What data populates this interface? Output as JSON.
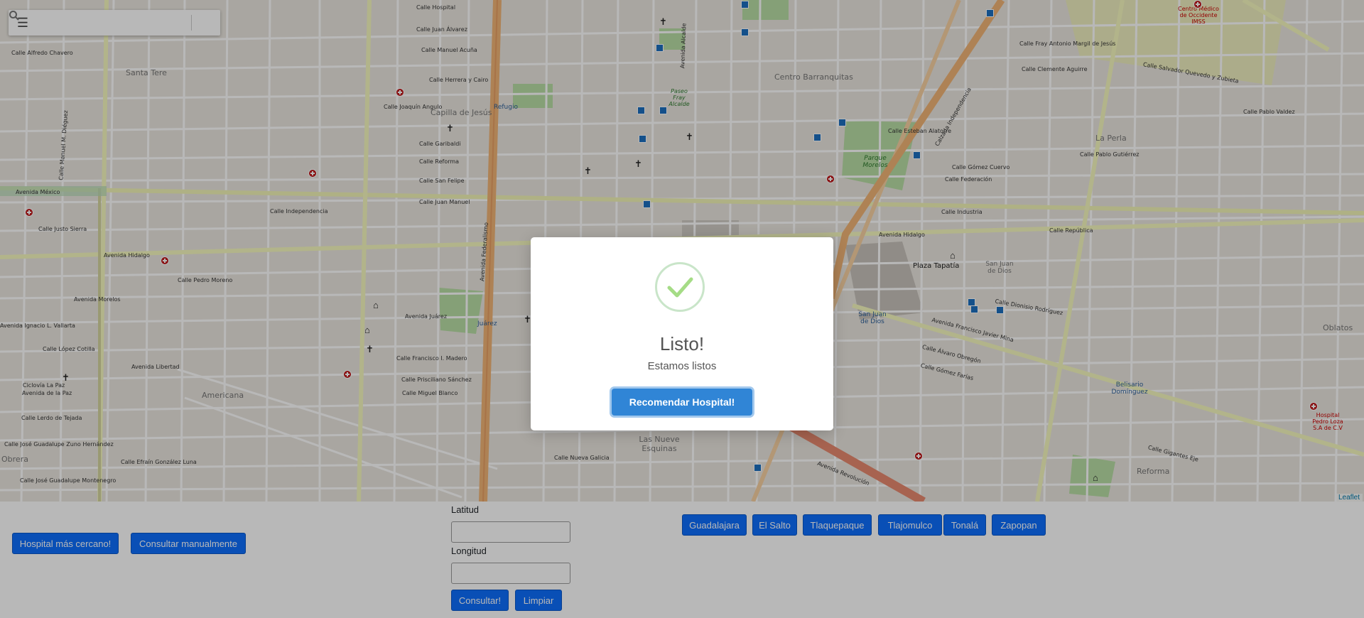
{
  "map": {
    "attribution": "Leaflet",
    "labels": {
      "santa_tere": "Santa Tere",
      "capilla": "Capilla de Jesús",
      "refugio": "Refugio",
      "paseo": "Paseo Fray Alcalde",
      "centro": "Centro Barranquitas",
      "parque": "Parque Morelos",
      "la_perla": "La Perla",
      "plaza": "Plaza Tapatía",
      "sjd": "San Juan de Dios",
      "sjd2": "San Juan de Dios",
      "juarez": "Juárez",
      "americana": "Americana",
      "obrera": "Obrera",
      "nueve": "Las Nueve Esquinas",
      "belisario": "Belisario Domínguez",
      "oblatos": "Oblatos",
      "reforma": "Reforma",
      "centro_medico": "Centro Médico de Occidente IMSS",
      "hosp_pedro": "Hospital Pedro Loza S.A de C.V",
      "av_mexico": "Avenida México",
      "av_hidalgo": "Avenida Hidalgo",
      "av_hidalgo2": "Avenida Hidalgo",
      "av_morelos": "Avenida Morelos",
      "av_juarez": "Avenida Juárez",
      "av_vallarta": "Avenida Ignacio L. Vallarta",
      "av_libertad": "Avenida Libertad",
      "av_la_paz": "Avenida de la Paz",
      "av_revolucion": "Avenida Revolución",
      "av_mina": "Avenida Francisco Javier Mina",
      "av_fed": "Avenida Federalismo",
      "av_alcalde": "Avenida Alcalde",
      "calz_indep": "Calzada Independencia",
      "c_hospital": "Calle Hospital",
      "c_juan_alvarez": "Calle Juan Álvarez",
      "c_manuel_acuna": "Calle Manuel Acuña",
      "c_herrera": "Calle Herrera y Cairo",
      "c_angulo": "Calle Joaquín Angulo",
      "c_garibaldi": "Calle Garibaldi",
      "c_reforma": "Calle Reforma",
      "c_san_felipe": "Calle San Felipe",
      "c_juan_manuel": "Calle Juan Manuel",
      "c_independencia": "Calle Independencia",
      "c_justo_sierra": "Calle Justo Sierra",
      "c_republica": "Calle República",
      "c_madero": "Calle Francisco I. Madero",
      "c_sanchez": "Calle Prisciliano Sánchez",
      "c_miguel_blanco": "Calle Miguel Blanco",
      "c_gigantes": "Calle Gigantes Eje",
      "c_gomez_farias": "Calle Gómez Farías",
      "c_federacion": "Calle Federación",
      "c_industria": "Calle Industria",
      "c_alvaro": "Calle Álvaro Obregón",
      "c_dionisio": "Calle Dionisio Rodríguez",
      "c_salvador": "Calle Salvador Quevedo y Zubieta",
      "c_esteban": "Calle Esteban Alatorre",
      "c_pablo_valdez": "Calle Pablo Valdez",
      "c_gomez_cuervo": "Calle Gómez Cuervo",
      "c_alfredo": "Calle Alfredo Chavero",
      "c_tejada": "Calle Lerdo de Tejada",
      "c_efrain": "Calle Efraín González Luna",
      "c_guadalupe": "Calle José Guadalupe Montenegro",
      "c_zuno": "Calle José Guadalupe Zuno Hernández",
      "c_nueva_galicia": "Calle Nueva Galicia",
      "c_lopez_cotilla": "Calle López Cotilla",
      "c_pedro_moreno": "Calle Pedro Moreno",
      "c_la_paz": "Ciclovía La Paz",
      "c_manuel_dieguez": "Calle Manuel M. Diéguez",
      "c_fray_angulo": "Calle Fray Antonio Margil de Jesús",
      "c_clemente": "Calle Clemente Aguirre",
      "c_pablo_gutierrez": "Calle Pablo Gutiérrez"
    }
  },
  "panel": {
    "nearest_label": "Hospital más cercano!",
    "manual_label": "Consultar manualmente",
    "lat_label": "Latitud",
    "lon_label": "Longitud",
    "lat_value": "",
    "lon_value": "",
    "consult_label": "Consultar!",
    "clear_label": "Limpiar",
    "municipalities": [
      "Guadalajara",
      "El Salto",
      "Tlaquepaque",
      "Tlajomulco",
      "Tonalá",
      "Zapopan"
    ]
  },
  "modal": {
    "title": "Listo!",
    "text": "Estamos listos",
    "button_label": "Recomendar Hospital!"
  },
  "colors": {
    "primary": "#0d6efd",
    "modal_button": "#3085d6",
    "success": "#a5dc86",
    "hospital": "#c0191b",
    "bus_stop": "#1d6fbf"
  }
}
